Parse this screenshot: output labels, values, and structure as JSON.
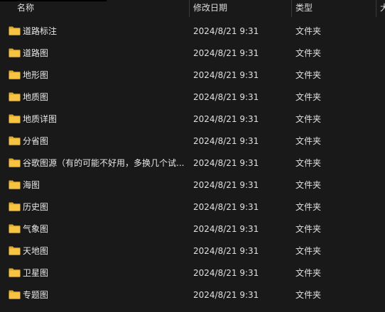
{
  "columns": {
    "name": "名称",
    "modified": "修改日期",
    "type": "类型",
    "size": "大"
  },
  "colors": {
    "background": "#191919",
    "folder_body": "#f6c343",
    "folder_tab": "#e0a92a"
  },
  "rows": [
    {
      "name": "道路标注",
      "modified": "2024/8/21 9:31",
      "type": "文件夹"
    },
    {
      "name": "道路图",
      "modified": "2024/8/21 9:31",
      "type": "文件夹"
    },
    {
      "name": "地形图",
      "modified": "2024/8/21 9:31",
      "type": "文件夹"
    },
    {
      "name": "地质图",
      "modified": "2024/8/21 9:31",
      "type": "文件夹"
    },
    {
      "name": "地质详图",
      "modified": "2024/8/21 9:31",
      "type": "文件夹"
    },
    {
      "name": "分省图",
      "modified": "2024/8/21 9:31",
      "type": "文件夹"
    },
    {
      "name": "谷歌图源（有的可能不好用，多换几个试...",
      "modified": "2024/8/21 9:31",
      "type": "文件夹"
    },
    {
      "name": "海图",
      "modified": "2024/8/21 9:31",
      "type": "文件夹"
    },
    {
      "name": "历史图",
      "modified": "2024/8/21 9:31",
      "type": "文件夹"
    },
    {
      "name": "气象图",
      "modified": "2024/8/21 9:31",
      "type": "文件夹"
    },
    {
      "name": "天地图",
      "modified": "2024/8/21 9:31",
      "type": "文件夹"
    },
    {
      "name": "卫星图",
      "modified": "2024/8/21 9:31",
      "type": "文件夹"
    },
    {
      "name": "专题图",
      "modified": "2024/8/21 9:31",
      "type": "文件夹"
    }
  ]
}
